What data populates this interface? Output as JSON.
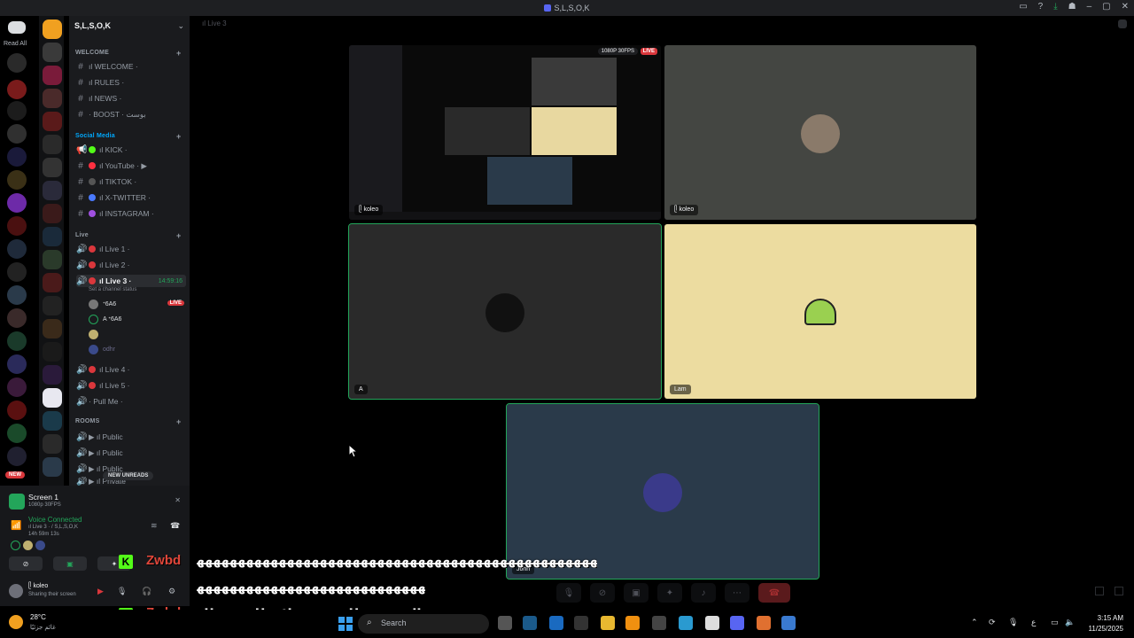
{
  "window": {
    "title": "S,L,S,O,K"
  },
  "rail": {
    "read_all": "Read All",
    "new_label": "NEW"
  },
  "server": {
    "name": "S,L,S,O,K"
  },
  "categories": {
    "welcome": "WELCOME",
    "social": "Social Media",
    "live": "Live",
    "rooms": "ROOMS"
  },
  "channels": {
    "welcome": "ıl WELCOME ·",
    "rules": "ıl RULES ·",
    "news": "ıl NEWS ·",
    "boost": "· BOOST · بوست",
    "kick": "ıl KICK ·",
    "youtube": "ıl YouTube · ▶",
    "tiktok": "ıl TIKTOK ·",
    "twitter": "ıl X-TWITTER ·",
    "instagram": "ıl INSTAGRAM ·",
    "live1": "ıl Live 1 ·",
    "live2": "ıl Live 2 ·",
    "live3": "ıl Live 3 ·",
    "live3_time": "14:59:16",
    "live3_status": "Set a channel status",
    "live4": "ıl Live 4 ·",
    "live5": "ıl Live 5 ·",
    "pullme": "· Pull Me ·",
    "public1": "▶ ıl Public",
    "public2": "▶ ıl Public",
    "public3": "▶ ıl Public",
    "private": "▶ ıl Private"
  },
  "members": [
    {
      "name": "ᐩ6A6",
      "live": "LIVE"
    },
    {
      "name": "A ᐩ6A6"
    },
    {
      "name": ""
    },
    {
      "name": "odhr"
    }
  ],
  "new_unreads": "NEW UNREADS",
  "user_panel": {
    "screen_title": "Screen 1",
    "screen_sub": "1080p 30FPS",
    "voice_connected": "Voice Connected",
    "voice_channel": "ıl Live 3 · / S,L,S,O,K",
    "voice_time": "14h 59m 13s",
    "username": "ᥫ koleo",
    "user_status": "Sharing their screen"
  },
  "topbar": {
    "label": "ıl Live 3"
  },
  "tiles": {
    "stream": {
      "tag": "ᥫ koleo",
      "quality": "1080P 30FPS",
      "live": "LIVE"
    },
    "cam": {
      "tag": "ᥫ koleo"
    },
    "a": {
      "tag": "A"
    },
    "lam": {
      "tag": "Lam"
    },
    "john": {
      "tag": "John"
    }
  },
  "subtitles": {
    "name": "Zwbd",
    "line1": "ﻬﻬﻬﻬﻬﻬﻬﻬﻬﻬﻬﻬﻬﻬﻬﻬﻬﻬﻬﻬﻬﻬﻬﻬﻬﻬﻬﻬﻬﻬﻬﻬﻬﻬﻬﻬﻬﻬﻬﻬﻬﻬﻬﻬﻬﻬﻬﻬﻬﻬﻬﻬﻬﻬﻬﻬﻬﻬﻬﻬﻬﻬﻬﻬﻬﻬﻬﻬﻬﻬﻬ",
    "line2": "ﻬﻬﻬﻬﻬﻬﻬﻬﻬﻬﻬﻬﻬﻬﻬﻬﻬﻬﻬﻬﻬﻬﻬﻬﻬﻬﻬﻬﻬﻬﻬﻬﻬﻬﻬﻬﻬﻬﻬﻬﻬﻬﻬﻬﻬﻬﻬﻬﻬﻬ",
    "line3": "بنص المعمعه طلع دفتر ملاحظات يقولك"
  },
  "taskbar": {
    "temp": "28°C",
    "condition": "غائم جزئيًا",
    "search": "Search",
    "lang": "ع",
    "time": "3:15 AM",
    "date": "11/25/2025"
  },
  "colors": {
    "accent": "#5865f2",
    "online": "#23a55a",
    "live": "#da373c",
    "kick": "#53fc18"
  }
}
